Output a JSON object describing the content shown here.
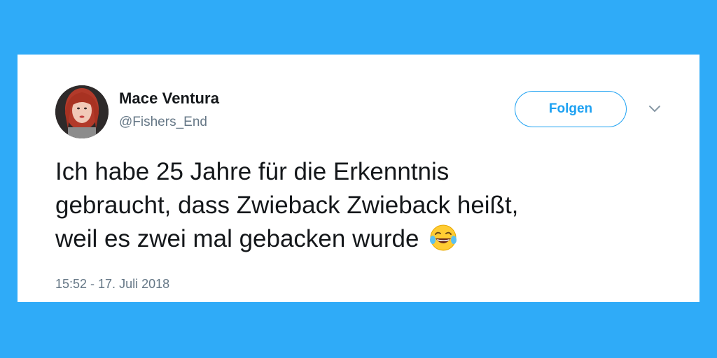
{
  "tweet": {
    "author": {
      "name": "Mace Ventura",
      "handle": "@Fishers_End"
    },
    "follow_label": "Folgen",
    "text_lines": [
      "Ich habe 25 Jahre für die Erkenntnis",
      "gebraucht, dass Zwieback Zwieback heißt,",
      "weil es zwei mal gebacken wurde"
    ],
    "emoji": "face-with-tears-of-joy",
    "timestamp": "15:52 - 17. Juli 2018"
  },
  "colors": {
    "background": "#2fabf8",
    "card": "#ffffff",
    "accent": "#1da1f2",
    "text": "#14171a",
    "muted": "#657786"
  }
}
